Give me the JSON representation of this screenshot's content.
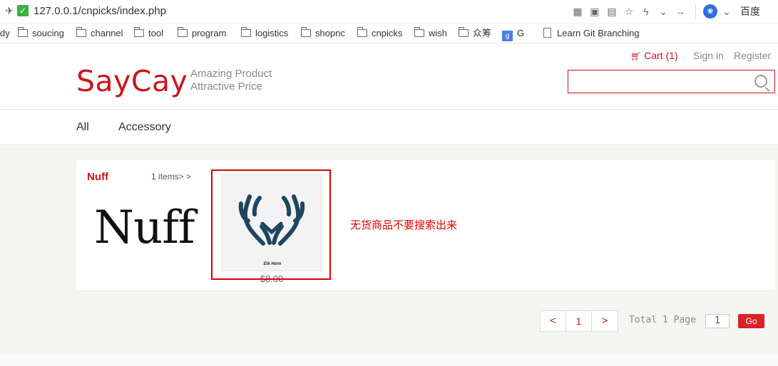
{
  "browser": {
    "url": "127.0.0.1/cnpicks/index.php",
    "search_engine_label": "百度",
    "icons": [
      "rocket-icon",
      "check-icon",
      "qr-icon",
      "translate-icon",
      "reader-icon",
      "star-icon",
      "bolt-icon",
      "chevron-down-icon",
      "forward-arrow-icon",
      "paw-icon"
    ]
  },
  "bookmarks": [
    {
      "label": "dy",
      "icon": "none"
    },
    {
      "label": "soucing",
      "icon": "folder-icon"
    },
    {
      "label": "channel",
      "icon": "folder-icon"
    },
    {
      "label": "tool",
      "icon": "folder-icon"
    },
    {
      "label": "program",
      "icon": "folder-icon"
    },
    {
      "label": "logistics",
      "icon": "folder-icon"
    },
    {
      "label": "shopnc",
      "icon": "folder-icon"
    },
    {
      "label": "cnpicks",
      "icon": "folder-icon"
    },
    {
      "label": "wish",
      "icon": "folder-icon"
    },
    {
      "label": "众筹",
      "icon": "folder-icon"
    },
    {
      "label": "G",
      "icon": "google-icon"
    },
    {
      "label": "Learn Git Branching",
      "icon": "page-icon"
    }
  ],
  "header": {
    "cart_label": "Cart (1)",
    "signin_label": "Sign in",
    "register_label": "Register",
    "logo_text": "SayCay",
    "tagline_line1": "Amazing Product",
    "tagline_line2": "Attractive Price",
    "search_value": "",
    "brand_color": "#c8161d"
  },
  "nav": {
    "categories": [
      "All",
      "Accessory"
    ]
  },
  "brand_block": {
    "name": "Nuff",
    "items_count": "1",
    "items_suffix": " items> >",
    "logo_text": "Nuff",
    "product": {
      "caption": "Elk Horn",
      "price": "$8.00"
    },
    "annotation": "无货商品不要搜索出来",
    "annotation_color": "#e00000"
  },
  "pagination": {
    "prev": "<",
    "current": "1",
    "next": ">",
    "total_text": "Total 1 Page",
    "input_value": "1",
    "go_label": "Go"
  }
}
